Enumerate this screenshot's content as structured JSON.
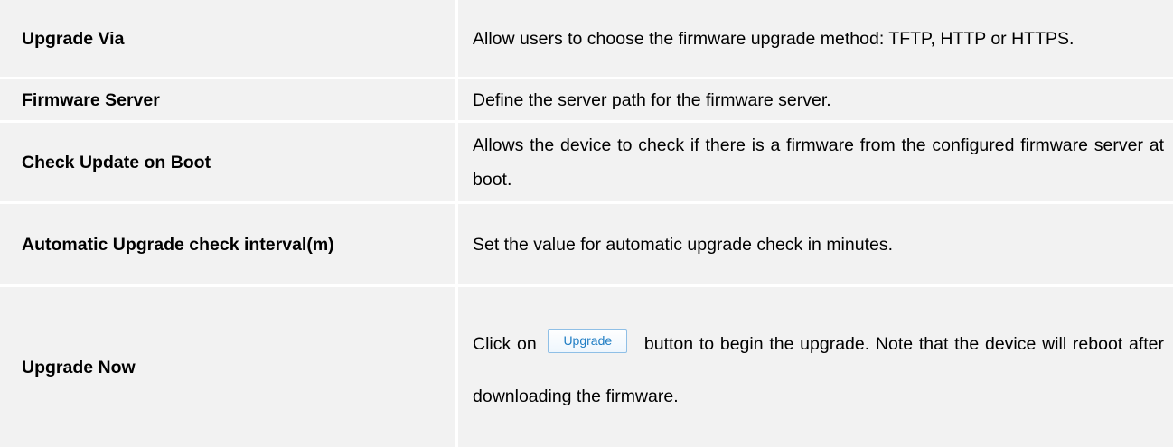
{
  "rows": [
    {
      "label": "Upgrade Via",
      "description": "Allow users to choose the firmware upgrade method: TFTP, HTTP or HTTPS."
    },
    {
      "label": "Firmware Server",
      "description": "Define the server path for the firmware server."
    },
    {
      "label": "Check Update on Boot",
      "description": "Allows the device to check if there is a firmware from the configured firmware server at boot."
    },
    {
      "label": "Automatic Upgrade check interval(m)",
      "description": "Set the value for automatic upgrade check in minutes."
    },
    {
      "label": "Upgrade Now",
      "description_before": "Click on",
      "button_label": "Upgrade",
      "description_after": "button to begin the upgrade. Note that the device will reboot after downloading the firmware."
    }
  ]
}
